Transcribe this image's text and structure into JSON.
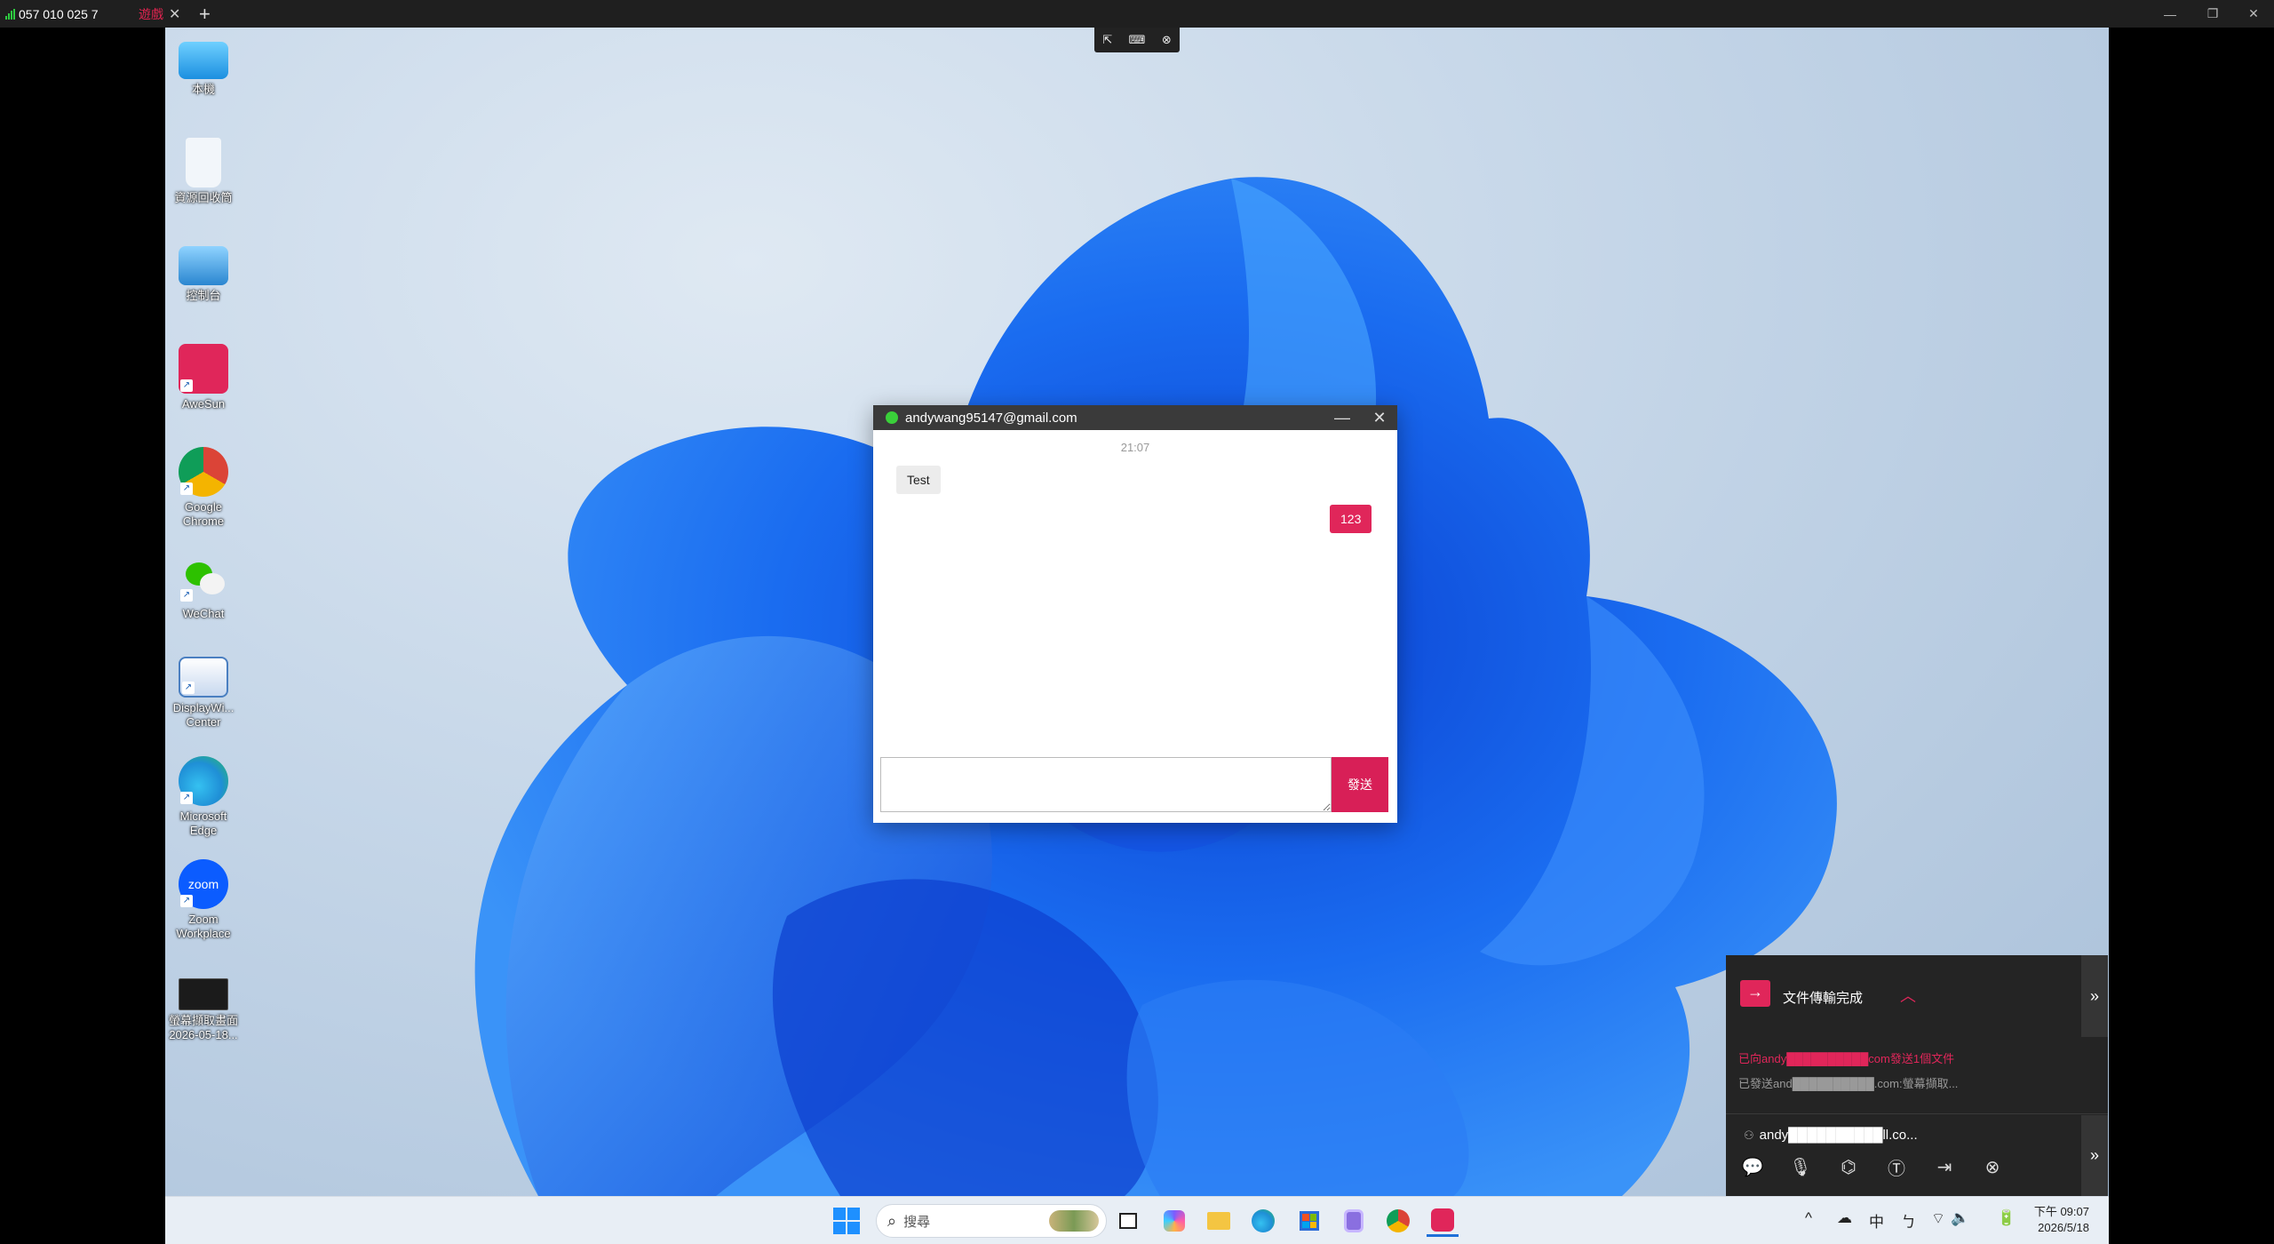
{
  "client_bar": {
    "connection_id": "057 010 025 7",
    "tab_label": "遊戲",
    "close_glyph": "✕",
    "add_glyph": "+",
    "window_controls": {
      "minimize": "—",
      "restore": "❐",
      "close": "✕"
    }
  },
  "remote_toolbar": {
    "icons": [
      "pointer-icon",
      "keyboard-icon",
      "close-icon"
    ]
  },
  "desktop_icons": [
    {
      "label": "本機",
      "icon": "monitor-icon",
      "color": "#2aa3e8",
      "shortcut": false
    },
    {
      "label": "資源回收筒",
      "icon": "recycle-bin-icon",
      "color": "#e8eef5",
      "shortcut": false
    },
    {
      "label": "控制台",
      "icon": "control-panel-icon",
      "color": "#3aa0d8",
      "shortcut": false
    },
    {
      "label": "AweSun",
      "icon": "awesun-icon",
      "color": "#e0265a",
      "shortcut": true
    },
    {
      "label": "Google Chrome",
      "icon": "chrome-icon",
      "color": "#db4437",
      "shortcut": true
    },
    {
      "label": "WeChat",
      "icon": "wechat-icon",
      "color": "#2dc100",
      "shortcut": true
    },
    {
      "label": "DisplayWi... Center",
      "icon": "display-center-icon",
      "color": "#4a7fc1",
      "shortcut": true
    },
    {
      "label": "Microsoft Edge",
      "icon": "edge-icon",
      "color": "#1f8fd6",
      "shortcut": true
    },
    {
      "label": "Zoom Workplace",
      "icon": "zoom-icon",
      "color": "#0b5cff",
      "shortcut": true
    },
    {
      "label": "螢幕擷取畫面 2026-05-18...",
      "icon": "screenshot-file-icon",
      "color": "#222222",
      "shortcut": false
    }
  ],
  "chat": {
    "title": "andywang95147@gmail.com",
    "status_color": "#3ad03a",
    "minimize": "—",
    "close": "✕",
    "timestamp": "21:07",
    "messages": [
      {
        "direction": "in",
        "text": "Test"
      },
      {
        "direction": "out",
        "text": "123"
      }
    ],
    "input_value": "",
    "send_label": "發送",
    "accent": "#d81f57"
  },
  "transfer": {
    "title": "文件傳輸完成",
    "line1": "已向andy██████████com發送1個文件",
    "line2": "已發送and██████████.com:螢幕擷取...",
    "user": "andy██████████ll.co...",
    "expand_glyph": "»",
    "tools": [
      "chat-icon",
      "microphone-icon",
      "camera-icon",
      "text-icon",
      "file-transfer-icon",
      "disconnect-icon"
    ]
  },
  "taskbar": {
    "search_placeholder": "搜尋",
    "apps": [
      "task-view-icon",
      "copilot-icon",
      "file-explorer-icon",
      "edge-icon",
      "store-icon",
      "scrcpy-icon",
      "chrome-icon",
      "awesun-icon"
    ],
    "tray": {
      "chevron": "^",
      "ime": "中",
      "ime_mode": "ㄅ"
    },
    "clock": {
      "time": "下午 09:07",
      "date": "2026/5/18"
    }
  }
}
